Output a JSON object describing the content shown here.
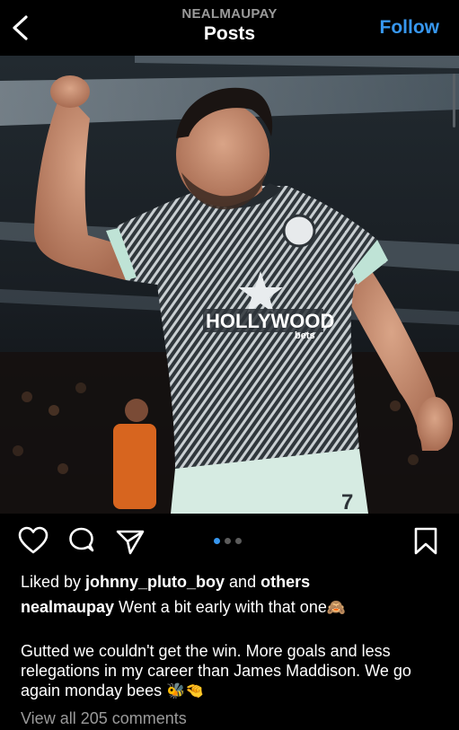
{
  "header": {
    "username": "NEALMAUPAY",
    "title": "Posts",
    "follow_label": "Follow"
  },
  "icons": {
    "back": "chevron-left-icon",
    "like": "heart-icon",
    "comment": "comment-bubble-icon",
    "share": "paper-plane-icon",
    "save": "bookmark-icon"
  },
  "post": {
    "shirt_sponsor": "HOLLYWOOD",
    "shirt_sponsor_sub": "bets",
    "carousel": {
      "count": 3,
      "active_index": 0
    },
    "likes": {
      "prefix": "Liked by ",
      "user": "johnny_pluto_boy",
      "middle": " and ",
      "suffix": "others"
    },
    "caption": {
      "author": "nealmaupay",
      "first_line": " Went a bit early with that one",
      "first_line_emoji": "🙈",
      "body": "Gutted we couldn't get the win. More goals and less relegations in my career than James Maddison. We go again monday bees",
      "body_emoji": "🐝🤏"
    },
    "view_comments": "View all 205 comments"
  },
  "colors": {
    "background": "#000000",
    "accent": "#3797f0",
    "muted": "#9a9a9a",
    "jersey": "#2d3338",
    "trim": "#bfe3d6"
  }
}
